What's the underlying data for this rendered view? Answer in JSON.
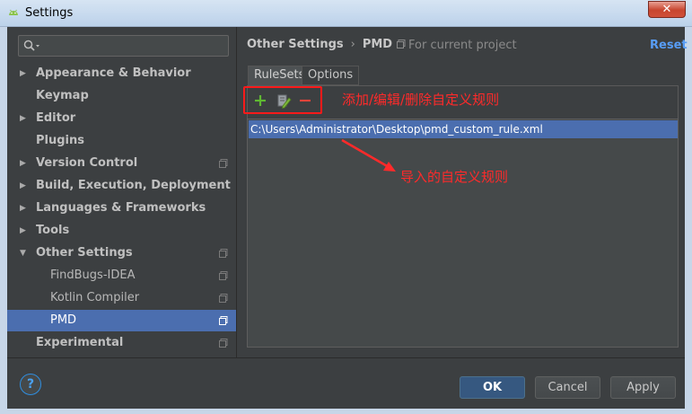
{
  "window": {
    "title": "Settings",
    "close_label": "✕"
  },
  "search": {
    "placeholder": ""
  },
  "sidebar": {
    "items": [
      {
        "label": "Appearance & Behavior",
        "expandable": true,
        "project": false
      },
      {
        "label": "Keymap",
        "expandable": false,
        "project": false
      },
      {
        "label": "Editor",
        "expandable": true,
        "project": false
      },
      {
        "label": "Plugins",
        "expandable": false,
        "project": false
      },
      {
        "label": "Version Control",
        "expandable": true,
        "project": true
      },
      {
        "label": "Build, Execution, Deployment",
        "expandable": true,
        "project": false
      },
      {
        "label": "Languages & Frameworks",
        "expandable": true,
        "project": false
      },
      {
        "label": "Tools",
        "expandable": true,
        "project": false
      },
      {
        "label": "Other Settings",
        "expandable": true,
        "expanded": true,
        "project": true
      },
      {
        "label": "FindBugs-IDEA",
        "child": true,
        "project": true
      },
      {
        "label": "Kotlin Compiler",
        "child": true,
        "project": true
      },
      {
        "label": "PMD",
        "child": true,
        "project": true,
        "selected": true
      },
      {
        "label": "Experimental",
        "expandable": false,
        "project": true
      }
    ]
  },
  "breadcrumb": {
    "parent": "Other Settings",
    "separator": "›",
    "current": "PMD"
  },
  "scope_label": "For current project",
  "reset_label": "Reset",
  "tabs": [
    {
      "label": "RuleSets",
      "active": true
    },
    {
      "label": "Options",
      "active": false
    }
  ],
  "toolbar": {
    "add_icon": "plus-icon",
    "edit_icon": "edit-icon",
    "remove_icon": "minus-icon"
  },
  "rulesets": [
    "C:\\Users\\Administrator\\Desktop\\pmd_custom_rule.xml"
  ],
  "annotations": {
    "toolbar_note": "添加/编辑/删除自定义规则",
    "import_note": "导入的自定义规则",
    "color": "#ff2a2a"
  },
  "buttons": {
    "help": "?",
    "ok": "OK",
    "cancel": "Cancel",
    "apply": "Apply"
  },
  "colors": {
    "selection": "#4b6eaf",
    "link": "#589df6",
    "background": "#3c3f41"
  }
}
